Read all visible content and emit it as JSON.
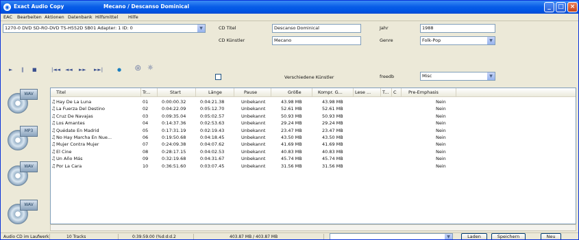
{
  "window": {
    "title": "Exact Audio Copy",
    "song": "Mecano / Descanso Dominical"
  },
  "menu": [
    "EAC",
    "Bearbeiten",
    "Aktionen",
    "Datenbank",
    "Hilfsmittel",
    "Hilfe"
  ],
  "drive": {
    "value": "1270-0 DVD SD-RO-DVD TS-H552D SB01 Adapter: 1 ID: 0"
  },
  "cd": {
    "title_label": "CD Titel",
    "title_value": "Descanso Dominical",
    "artist_label": "CD Künstler",
    "artist_value": "Mecano",
    "various_label": "Verschiedene Künstler",
    "year_label": "Jahr",
    "year_value": "1988",
    "genre_label": "Genre",
    "genre_value": "Folk-Pop",
    "freedb_label": "freedb",
    "freedb_value": "Misc"
  },
  "toolbar": [
    "►",
    "‖",
    "■",
    "|◄◄",
    "◄◄",
    "►►",
    "►►|",
    "●",
    "◎",
    "☼"
  ],
  "sidebar_icons": [
    "cd-copy-icon",
    "cd-compress-icon",
    "cd-tracks-icon",
    "cd-write-icon"
  ],
  "columns": [
    "Titel",
    "Tr...",
    "Start",
    "Länge",
    "Pause",
    "Größe",
    "Kompr. G...",
    "Lese ...",
    "T...",
    "C",
    "Pre-Emphasis"
  ],
  "tracks": [
    [
      "Hay De La Luna",
      "01",
      "0:00:00.32",
      "0:04:21.38",
      "Unbekannt",
      "43.98 MB",
      "43.98 MB",
      "Nein"
    ],
    [
      "La Fuerza Del Destino",
      "02",
      "0:04:22.09",
      "0:05:12.70",
      "Unbekannt",
      "52.61 MB",
      "52.61 MB",
      "Nein"
    ],
    [
      "Cruz De Navajas",
      "03",
      "0:09:35.04",
      "0:05:02.57",
      "Unbekannt",
      "50.93 MB",
      "50.93 MB",
      "Nein"
    ],
    [
      "Los Amantes",
      "04",
      "0:14:37.36",
      "0:02:53.63",
      "Unbekannt",
      "29.24 MB",
      "29.24 MB",
      "Nein"
    ],
    [
      "Quédate En Madrid",
      "05",
      "0:17:31.19",
      "0:02:19.43",
      "Unbekannt",
      "23.47 MB",
      "23.47 MB",
      "Nein"
    ],
    [
      "No Hay Marcha En Nue...",
      "06",
      "0:19:50.68",
      "0:04:18.45",
      "Unbekannt",
      "43.50 MB",
      "43.50 MB",
      "Nein"
    ],
    [
      "Mujer Contra Mujer",
      "07",
      "0:24:09.38",
      "0:04:07.62",
      "Unbekannt",
      "41.69 MB",
      "41.69 MB",
      "Nein"
    ],
    [
      "El Cine",
      "08",
      "0:28:17.15",
      "0:04:02.53",
      "Unbekannt",
      "40.83 MB",
      "40.83 MB",
      "Nein"
    ],
    [
      "Un Año Más",
      "09",
      "0:32:19.68",
      "0:04:31.67",
      "Unbekannt",
      "45.74 MB",
      "45.74 MB",
      "Nein"
    ],
    [
      "Por La Cara",
      "10",
      "0:36:51.60",
      "0:03:07.45",
      "Unbekannt",
      "31.56 MB",
      "31.56 MB",
      "Nein"
    ]
  ],
  "status": {
    "drive": "Audio CD im Laufwerk",
    "tracks": "10 Tracks",
    "length": "0:39:59.00 (%d:d:d.2",
    "size": "403.87 MB / 403.87 MB",
    "load_button": "Laden",
    "save_button": "Speichern",
    "new_button": "Neu"
  }
}
